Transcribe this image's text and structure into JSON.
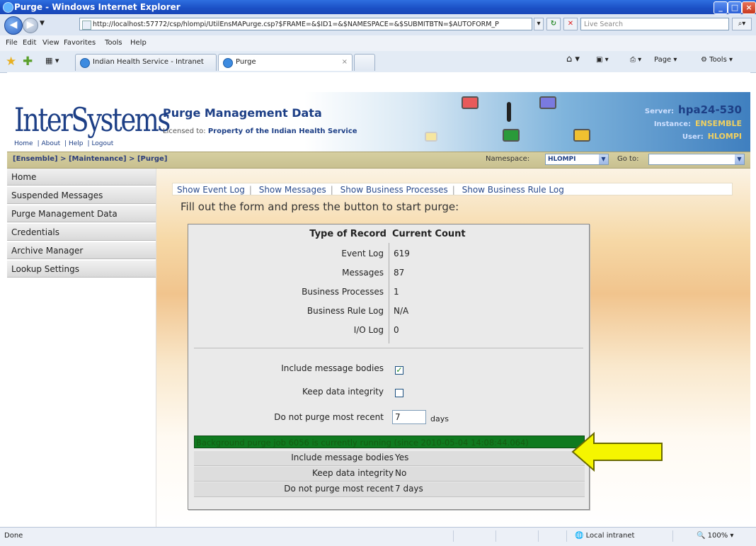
{
  "window": {
    "title": "Purge - Windows Internet Explorer"
  },
  "address_bar": {
    "url": "http://localhost:57772/csp/hlompi/UtilEnsMAPurge.csp?$FRAME=&$ID1=&$NAMESPACE=&$SUBMITBTN=$AUTOFORM_P",
    "search_placeholder": "Live Search"
  },
  "menu": [
    "File",
    "Edit",
    "View",
    "Favorites",
    "Tools",
    "Help"
  ],
  "tabs": [
    {
      "label": "Indian Health Service - Intranet"
    },
    {
      "label": "Purge"
    }
  ],
  "commands": {
    "page": "Page",
    "tools": "Tools"
  },
  "header": {
    "logo": "InterSystems",
    "logo_links": [
      "Home",
      "About",
      "Help",
      "Logout"
    ],
    "page_title": "Purge Management Data",
    "licensed_label": "Licensed to:",
    "licensed_value": "Property of the Indian Health Service",
    "server_label": "Server:",
    "server_value": "hpa24-530",
    "instance_label": "Instance:",
    "instance_value": "ENSEMBLE",
    "user_label": "User:",
    "user_value": "HLOMPI"
  },
  "breadcrumb": "[Ensemble] > [Maintenance] > [Purge]",
  "namespace": {
    "label": "Namespace:",
    "value": "HLOMPI"
  },
  "goto": {
    "label": "Go to:",
    "value": ""
  },
  "sidebar": {
    "items": [
      {
        "label": "Home"
      },
      {
        "label": "Suspended Messages"
      },
      {
        "label": "Purge Management Data"
      },
      {
        "label": "Credentials"
      },
      {
        "label": "Archive Manager"
      },
      {
        "label": "Lookup Settings"
      }
    ]
  },
  "links": [
    "Show Event Log",
    "Show Messages",
    "Show Business Processes",
    "Show Business Rule Log"
  ],
  "instructions": "Fill out the form and press the button to start purge:",
  "form": {
    "col_type": "Type of Record",
    "col_count": "Current Count",
    "rows": [
      {
        "type": "Event Log",
        "count": "619"
      },
      {
        "type": "Messages",
        "count": "87"
      },
      {
        "type": "Business Processes",
        "count": "1"
      },
      {
        "type": "Business Rule Log",
        "count": "N/A"
      },
      {
        "type": "I/O Log",
        "count": "0"
      }
    ],
    "include_bodies_label": "Include message bodies",
    "include_bodies_checked": true,
    "keep_integrity_label": "Keep data integrity",
    "keep_integrity_checked": false,
    "do_not_purge_label": "Do not purge most recent",
    "do_not_purge_value": "7",
    "days_label": "days",
    "banner": "Background purge job 6056 is currently running (since 2010-05-04 14:08:44.064)",
    "status": [
      {
        "label": "Include message bodies",
        "value": "Yes"
      },
      {
        "label": "Keep data integrity",
        "value": "No"
      },
      {
        "label": "Do not purge most recent",
        "value": "7 days"
      }
    ]
  },
  "status_bar": {
    "text": "Done",
    "zone": "Local intranet",
    "zoom": "100%"
  },
  "colors": {
    "banner_bg": "#0f7a1f",
    "arrow": "#f5f500",
    "accent": "#1d3f86"
  }
}
